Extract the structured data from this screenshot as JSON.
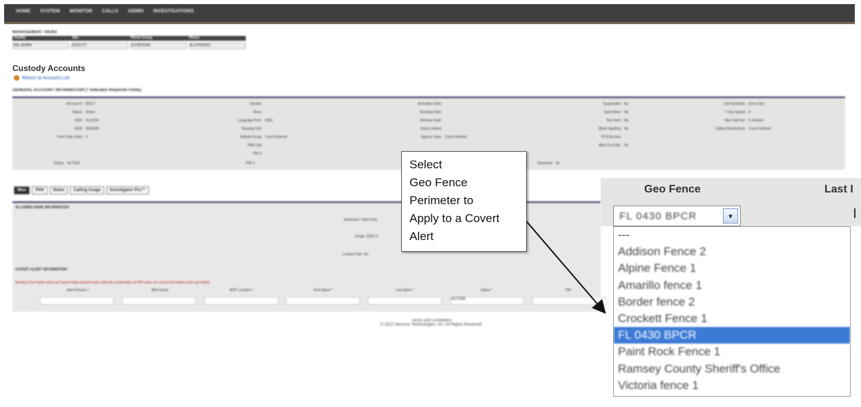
{
  "nav": {
    "items": [
      "HOME",
      "SYSTEM",
      "MONITOR",
      "CALLS",
      "ADMIN",
      "INVESTIGATIONS"
    ]
  },
  "management": {
    "title": "MANAGEMENT VIEWS",
    "headers": [
      "Facility",
      "Site",
      "Phone Group",
      "Phone"
    ],
    "selects": [
      "JAIL ADMIN",
      "FACILITY",
      "OUTBOUND",
      "ALLPHONES"
    ]
  },
  "page": {
    "title": "Custody Accounts",
    "back_link": "Return to Account List"
  },
  "general": {
    "heading": "GENERAL ACCOUNT INFORMATION",
    "required_note": "(* indicates Required Fields)",
    "col1": [
      {
        "label": "Account #:",
        "value": "00217"
      },
      {
        "label": "Status:",
        "value": "Active"
      },
      {
        "label": "SSN:",
        "value": "1122334"
      },
      {
        "label": "DOB:",
        "value": "00/00/00"
      },
      {
        "label": "Free Calls Used:",
        "value": "0"
      }
    ],
    "col2": [
      {
        "label": "Gender:",
        "value": ""
      },
      {
        "label": "Race:",
        "value": ""
      },
      {
        "label": "Language Pref.:",
        "value": "ENG"
      },
      {
        "label": "Housing Unit:",
        "value": ""
      },
      {
        "label": "Default Group:",
        "value": "Court Ordered"
      },
      {
        "label": "PAN Call:",
        "value": ""
      },
      {
        "label": "PIN #:",
        "value": ""
      }
    ],
    "col3": [
      {
        "label": "Activation Date:",
        "value": ""
      },
      {
        "label": "Booking Date:",
        "value": ""
      },
      {
        "label": "Release Date:",
        "value": ""
      },
      {
        "label": "Entry Limited:",
        "value": ""
      },
      {
        "label": "Agency Type:",
        "value": "Court Ordered"
      }
    ],
    "col4": [
      {
        "label": "Suspended:",
        "value": "No"
      },
      {
        "label": "Send Note:",
        "value": "No"
      },
      {
        "label": "Text Sent:",
        "value": "No"
      },
      {
        "label": "Block Spelling:",
        "value": "No"
      },
      {
        "label": "PCN Access:",
        "value": ""
      },
      {
        "label": "Web Cut Date:",
        "value": "No"
      }
    ],
    "col5": [
      {
        "label": "Call Schedule:",
        "value": "Every Day"
      },
      {
        "label": "7 Day Spend:",
        "value": "0"
      },
      {
        "label": "Max Call Dur:",
        "value": "0 minutes"
      },
      {
        "label": "Calling Restrictions:",
        "value": "Court Ordered"
      }
    ],
    "footer_status_label": "Status:",
    "footer_status_value": "ACTIVE",
    "footer_pin_label": "PIN #:",
    "footer_voicemail_label": "Voicemail:",
    "footer_voicemail_value": "No"
  },
  "tabs": [
    "Misc",
    "PAN",
    "Notes",
    "Calling Usage",
    "Investigator Pro™"
  ],
  "alias": {
    "heading": "ALLOWED NAME INFORMATION",
    "nickname_label": "Nickname:",
    "nickname_value": "Yelm Prod",
    "image_label": "Image:",
    "image_value": "2018 Tr",
    "lookup_label": "Lookup Date:",
    "lookup_value": "No"
  },
  "covert": {
    "heading": "COVERT ALERT INFORMATION",
    "note": "Inmates First Name and Last Name fields should match with the combination of PIN value on covert First Name and Last Name",
    "columns": [
      "Alert Reason *",
      "Alert Email",
      "BOP Location *",
      "First Name *",
      "Last Name *",
      "Status *",
      "PIN"
    ],
    "status_value": "ACTIVE"
  },
  "footer": {
    "terms": "Terms and Conditions",
    "copyright": "© 2012 Securus Technologies, Inc. All Rights Reserved."
  },
  "callout": {
    "lines": [
      "Select",
      "Geo Fence",
      "Perimeter to",
      "Apply to a Covert",
      "Alert"
    ]
  },
  "geofence": {
    "label": "Geo Fence",
    "next_column": "Last I",
    "selected_value": "FL 0430 BPCR",
    "dropdown_glyph": "▾",
    "options": [
      "---",
      "Addison Fence 2",
      "Alpine Fence 1",
      "Amarillo fence 1",
      "Border fence 2",
      "Crockett Fence 1",
      "FL 0430 BPCR",
      "Paint Rock Fence 1",
      "Ramsey County Sheriff's Office",
      "Victoria fence 1"
    ],
    "selected_index": 6,
    "highlight_color": "#3b7ad6"
  }
}
